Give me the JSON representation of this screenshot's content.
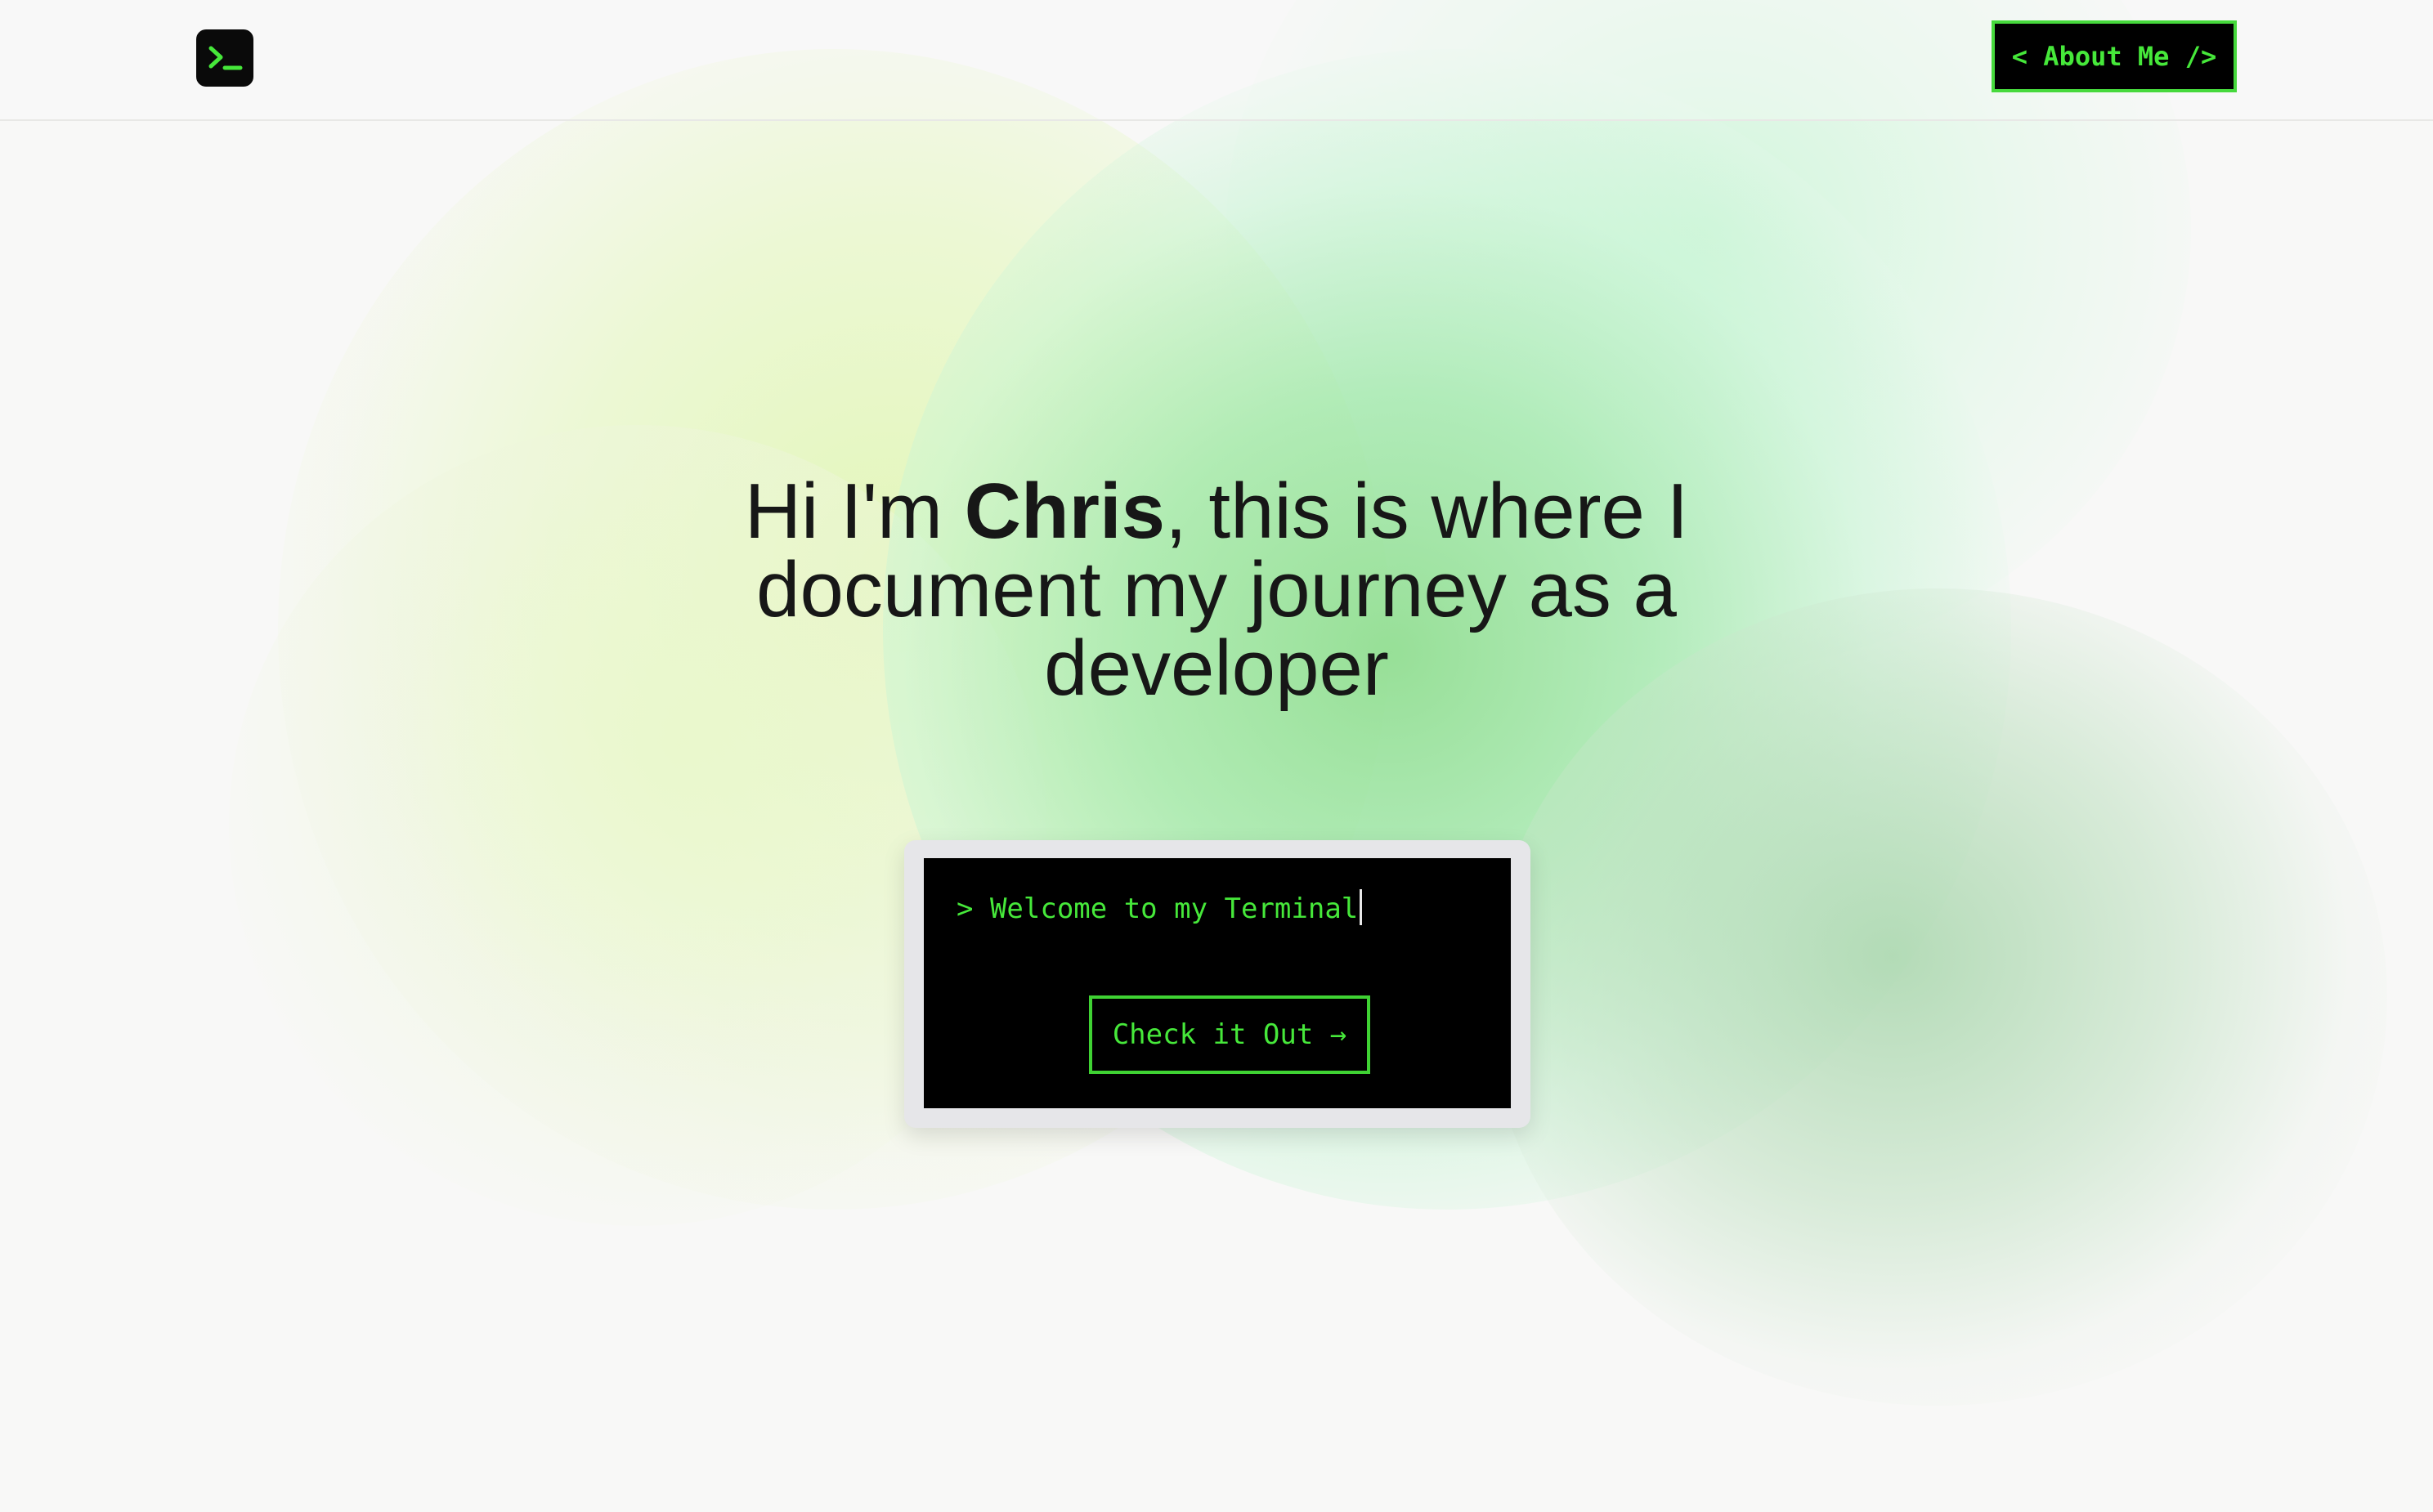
{
  "header": {
    "logo_icon": "terminal-prompt-icon",
    "about_button": "< About Me />"
  },
  "hero": {
    "line_prefix": "Hi I'm ",
    "name": "Chris",
    "line_suffix": ", this is where I document my journey as a developer"
  },
  "terminal": {
    "prompt_text": "> Welcome to my Terminal",
    "cta_label": "Check it Out →"
  },
  "colors": {
    "accent_green": "#46e83a",
    "terminal_bg": "#000000",
    "page_bg": "#f8f8f7",
    "text": "#171717"
  }
}
